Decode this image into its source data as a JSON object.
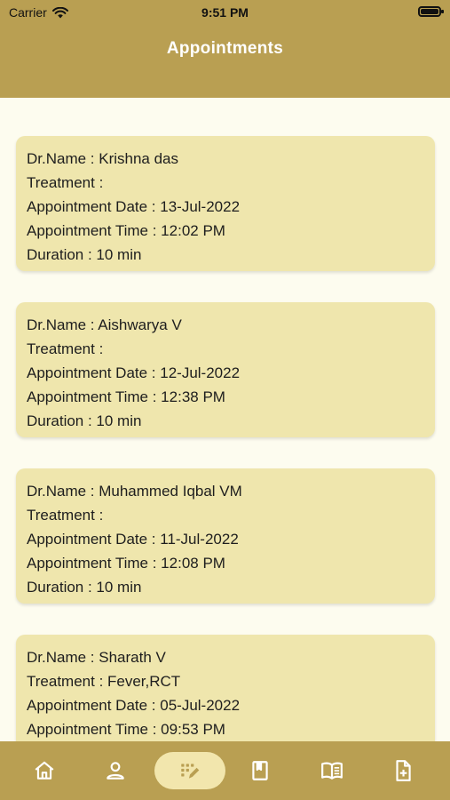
{
  "status_bar": {
    "carrier": "Carrier",
    "time": "9:51 PM"
  },
  "header": {
    "title": "Appointments"
  },
  "appointments": [
    {
      "name": "Dr.Name : Krishna das",
      "treatment": "Treatment :",
      "date": "Appointment Date : 13-Jul-2022",
      "time": "Appointment Time : 12:02 PM",
      "duration": "Duration : 10 min"
    },
    {
      "name": "Dr.Name : Aishwarya V",
      "treatment": "Treatment :",
      "date": "Appointment Date : 12-Jul-2022",
      "time": "Appointment Time : 12:38 PM",
      "duration": "Duration : 10 min"
    },
    {
      "name": "Dr.Name : Muhammed Iqbal VM",
      "treatment": "Treatment :",
      "date": "Appointment Date : 11-Jul-2022",
      "time": "Appointment Time : 12:08 PM",
      "duration": "Duration : 10 min"
    },
    {
      "name": "Dr.Name : Sharath V",
      "treatment": "Treatment : Fever,RCT",
      "date": "Appointment Date : 05-Jul-2022",
      "time": "Appointment Time : 09:53 PM",
      "duration": ""
    }
  ],
  "bottom_nav": {
    "items": [
      {
        "icon": "home-icon"
      },
      {
        "icon": "person-icon"
      },
      {
        "icon": "appointments-icon",
        "active": true
      },
      {
        "icon": "book-icon"
      },
      {
        "icon": "open-book-icon"
      },
      {
        "icon": "add-document-icon"
      }
    ]
  },
  "colors": {
    "header": "#b99f52",
    "card": "#efe6ad",
    "background": "#fdfcef",
    "active_pill": "#f2e6ad"
  }
}
